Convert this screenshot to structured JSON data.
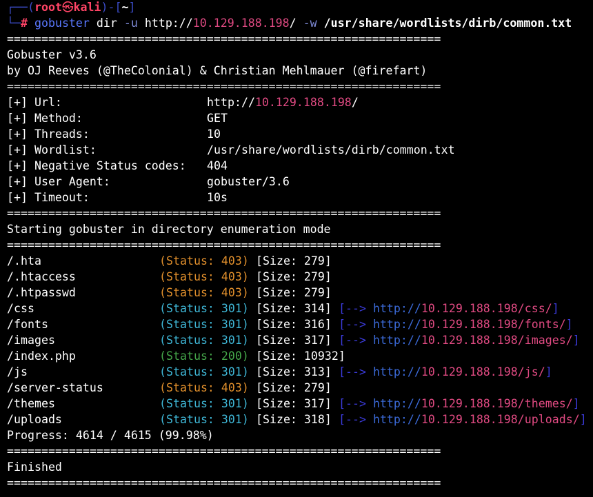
{
  "prompt": {
    "corner_top": "┌──(",
    "user": "root",
    "at": "㉿",
    "host": "kali",
    "mid": ")-[",
    "cwd": "~",
    "close": "]",
    "corner_bottom": "└─",
    "hash": "#",
    "cmd_name": "gobuster",
    "cmd_sub": " dir ",
    "flag_u": "-u",
    "url_prefix": " http://",
    "url_ip": "10.129.188.198",
    "url_suffix": "/ ",
    "flag_w": "-w",
    "wordlist": " /usr/share/wordlists/dirb/common.txt"
  },
  "separator": "===============================================================",
  "banner": {
    "title": "Gobuster v3.6",
    "authors": "by OJ Reeves (@TheColonial) & Christian Mehlmauer (@firefart)"
  },
  "config": [
    {
      "key": "[+] Url:",
      "value_prefix": "http://",
      "value_ip": "10.129.188.198",
      "value_suffix": "/"
    },
    {
      "key": "[+] Method:",
      "value": "GET"
    },
    {
      "key": "[+] Threads:",
      "value": "10"
    },
    {
      "key": "[+] Wordlist:",
      "value": "/usr/share/wordlists/dirb/common.txt"
    },
    {
      "key": "[+] Negative Status codes:",
      "value": "404"
    },
    {
      "key": "[+] User Agent:",
      "value": "gobuster/3.6"
    },
    {
      "key": "[+] Timeout:",
      "value": "10s"
    }
  ],
  "mode_text": "Starting gobuster in directory enumeration mode",
  "results": [
    {
      "path": "/.hta",
      "status": "(Status: 403)",
      "color": "#e2902c",
      "size": "[Size: 279]"
    },
    {
      "path": "/.htaccess",
      "status": "(Status: 403)",
      "color": "#e2902c",
      "size": "[Size: 279]"
    },
    {
      "path": "/.htpasswd",
      "status": "(Status: 403)",
      "color": "#e2902c",
      "size": "[Size: 279]"
    },
    {
      "path": "/css",
      "status": "(Status: 301)",
      "color": "#3fb8d8",
      "size": "[Size: 314]",
      "redirect_arrow": "[--> ",
      "redirect_proto": "http://",
      "redirect_ip": "10.129.188.198",
      "redirect_path": "/css/",
      "redirect_close": "]"
    },
    {
      "path": "/fonts",
      "status": "(Status: 301)",
      "color": "#3fb8d8",
      "size": "[Size: 316]",
      "redirect_arrow": "[--> ",
      "redirect_proto": "http://",
      "redirect_ip": "10.129.188.198",
      "redirect_path": "/fonts/",
      "redirect_close": "]"
    },
    {
      "path": "/images",
      "status": "(Status: 301)",
      "color": "#3fb8d8",
      "size": "[Size: 317]",
      "redirect_arrow": "[--> ",
      "redirect_proto": "http://",
      "redirect_ip": "10.129.188.198",
      "redirect_path": "/images/",
      "redirect_close": "]"
    },
    {
      "path": "/index.php",
      "status": "(Status: 200)",
      "color": "#45a84a",
      "size": "[Size: 10932]"
    },
    {
      "path": "/js",
      "status": "(Status: 301)",
      "color": "#3fb8d8",
      "size": "[Size: 313]",
      "redirect_arrow": "[--> ",
      "redirect_proto": "http://",
      "redirect_ip": "10.129.188.198",
      "redirect_path": "/js/",
      "redirect_close": "]"
    },
    {
      "path": "/server-status",
      "status": "(Status: 403)",
      "color": "#e2902c",
      "size": "[Size: 279]"
    },
    {
      "path": "/themes",
      "status": "(Status: 301)",
      "color": "#3fb8d8",
      "size": "[Size: 317]",
      "redirect_arrow": "[--> ",
      "redirect_proto": "http://",
      "redirect_ip": "10.129.188.198",
      "redirect_path": "/themes/",
      "redirect_close": "]"
    },
    {
      "path": "/uploads",
      "status": "(Status: 301)",
      "color": "#3fb8d8",
      "size": "[Size: 318]",
      "redirect_arrow": "[--> ",
      "redirect_proto": "http://",
      "redirect_ip": "10.129.188.198",
      "redirect_path": "/uploads/",
      "redirect_close": "]"
    }
  ],
  "progress": "Progress: 4614 / 4615 (99.98%)",
  "finished": "Finished",
  "colors": {
    "background": "#000000",
    "foreground": "#ffffff",
    "prompt_frame": "#3b4cc8",
    "prompt_user": "#ff4466",
    "ip": "#e04a82",
    "status_403": "#e2902c",
    "status_301": "#3fb8d8",
    "status_200": "#45a84a",
    "redirect": "#3a3ad8"
  }
}
